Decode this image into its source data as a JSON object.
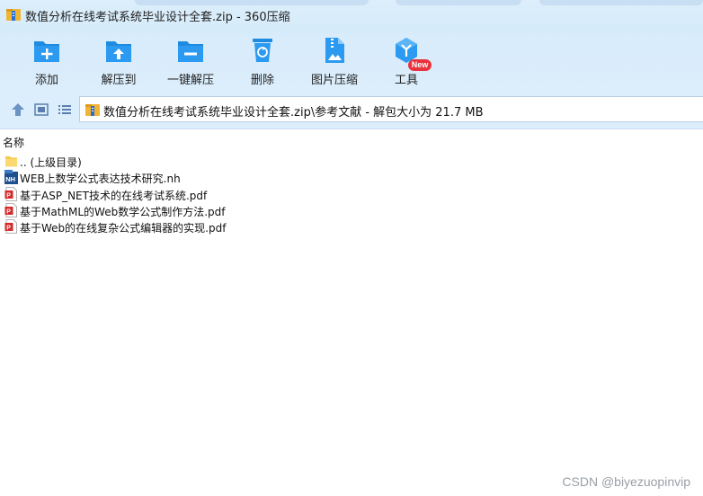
{
  "window": {
    "title": "数值分析在线考试系统毕业设计全套.zip - 360压缩"
  },
  "toolbar": {
    "items": [
      {
        "label": "添加",
        "icon": "add-icon"
      },
      {
        "label": "解压到",
        "icon": "extract-to-icon"
      },
      {
        "label": "一键解压",
        "icon": "one-click-extract-icon"
      },
      {
        "label": "删除",
        "icon": "delete-icon"
      },
      {
        "label": "图片压缩",
        "icon": "image-compress-icon"
      },
      {
        "label": "工具",
        "icon": "tools-icon"
      }
    ],
    "new_badge": "New"
  },
  "address": {
    "path": "数值分析在线考试系统毕业设计全套.zip\\参考文献 - 解包大小为 21.7 MB"
  },
  "list": {
    "column_name": "名称",
    "files": [
      {
        "name": ".. (上级目录)",
        "type": "folder"
      },
      {
        "name": "WEB上数学公式表达技术研究.nh",
        "type": "nh"
      },
      {
        "name": "基于ASP_NET技术的在线考试系统.pdf",
        "type": "pdf"
      },
      {
        "name": "基于MathML的Web数学公式制作方法.pdf",
        "type": "pdf"
      },
      {
        "name": "基于Web的在线复杂公式编辑器的实现.pdf",
        "type": "pdf"
      }
    ]
  },
  "watermark": "CSDN @biyezuopinvip",
  "colors": {
    "toolbar_bg": "#dcedfb",
    "icon_blue": "#1e8be0",
    "badge_red": "#e8333c"
  }
}
